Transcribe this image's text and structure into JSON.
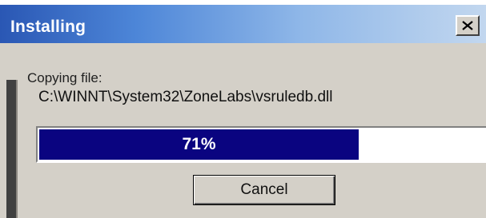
{
  "window": {
    "title": "Installing",
    "close_icon": "close-icon"
  },
  "status": {
    "caption": "Copying file:",
    "file_path": "C:\\WINNT\\System32\\ZoneLabs\\vsruledb.dll"
  },
  "progress": {
    "percent": 71,
    "label": "71%",
    "fill_color": "#0a0480"
  },
  "buttons": {
    "cancel_label": "Cancel"
  }
}
